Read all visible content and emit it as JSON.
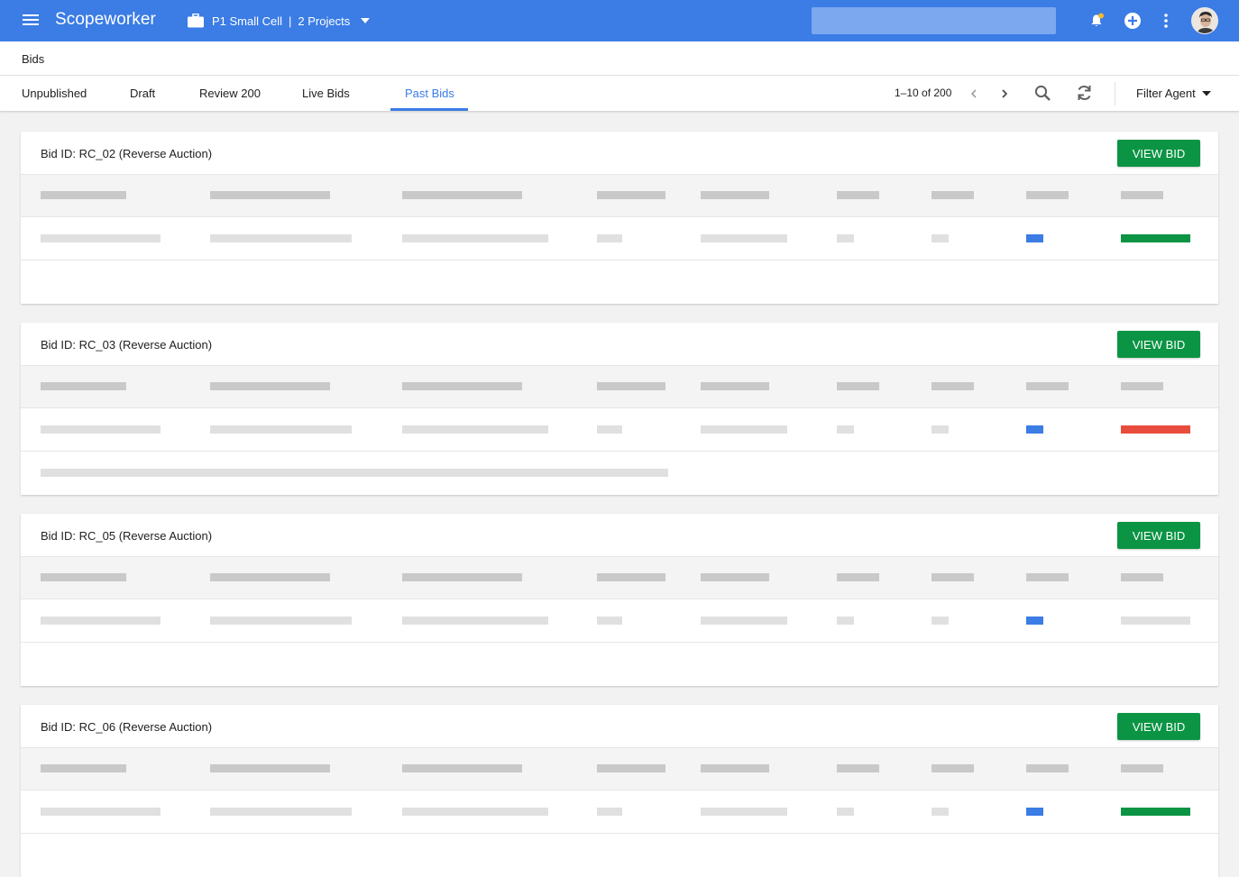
{
  "app": {
    "brand": "Scopeworker",
    "project_name": "P1 Small Cell",
    "project_count": "2 Projects",
    "search_placeholder": ""
  },
  "breadcrumb": "Bids",
  "tabs": [
    {
      "label": "Unpublished"
    },
    {
      "label": "Draft"
    },
    {
      "label": "Review 200"
    },
    {
      "label": "Live Bids"
    },
    {
      "label": "Past Bids",
      "active": true
    }
  ],
  "pager": "1–10 of 200",
  "filter_label": "Filter Agent",
  "view_bid_label": "VIEW BID",
  "colors": {
    "accent": "#3b7ce5",
    "button_green": "#0b9444",
    "status_green": "#0b9444",
    "status_red": "#e84c3d",
    "status_blue": "#3b7ce5"
  },
  "icons": [
    "menu-icon",
    "briefcase-icon",
    "chevron-down-icon",
    "search-icon",
    "bell-icon",
    "add-circle-icon",
    "more-vert-icon",
    "chevron-left-icon",
    "chevron-right-icon",
    "refresh-icon",
    "arrow-drop-down-icon"
  ],
  "bids": [
    {
      "title": "Bid ID: RC_02 (Reverse Auction)",
      "status_color": "#0b9444",
      "has_footer_line": false
    },
    {
      "title": "Bid ID: RC_03 (Reverse Auction)",
      "status_color": "#e84c3d",
      "has_footer_line": true
    },
    {
      "title": "Bid ID: RC_05 (Reverse Auction)",
      "status_color": "#e0e0e0",
      "has_footer_line": false
    },
    {
      "title": "Bid ID: RC_06 (Reverse Auction)",
      "status_color": "#0b9444",
      "has_footer_line": false
    }
  ]
}
